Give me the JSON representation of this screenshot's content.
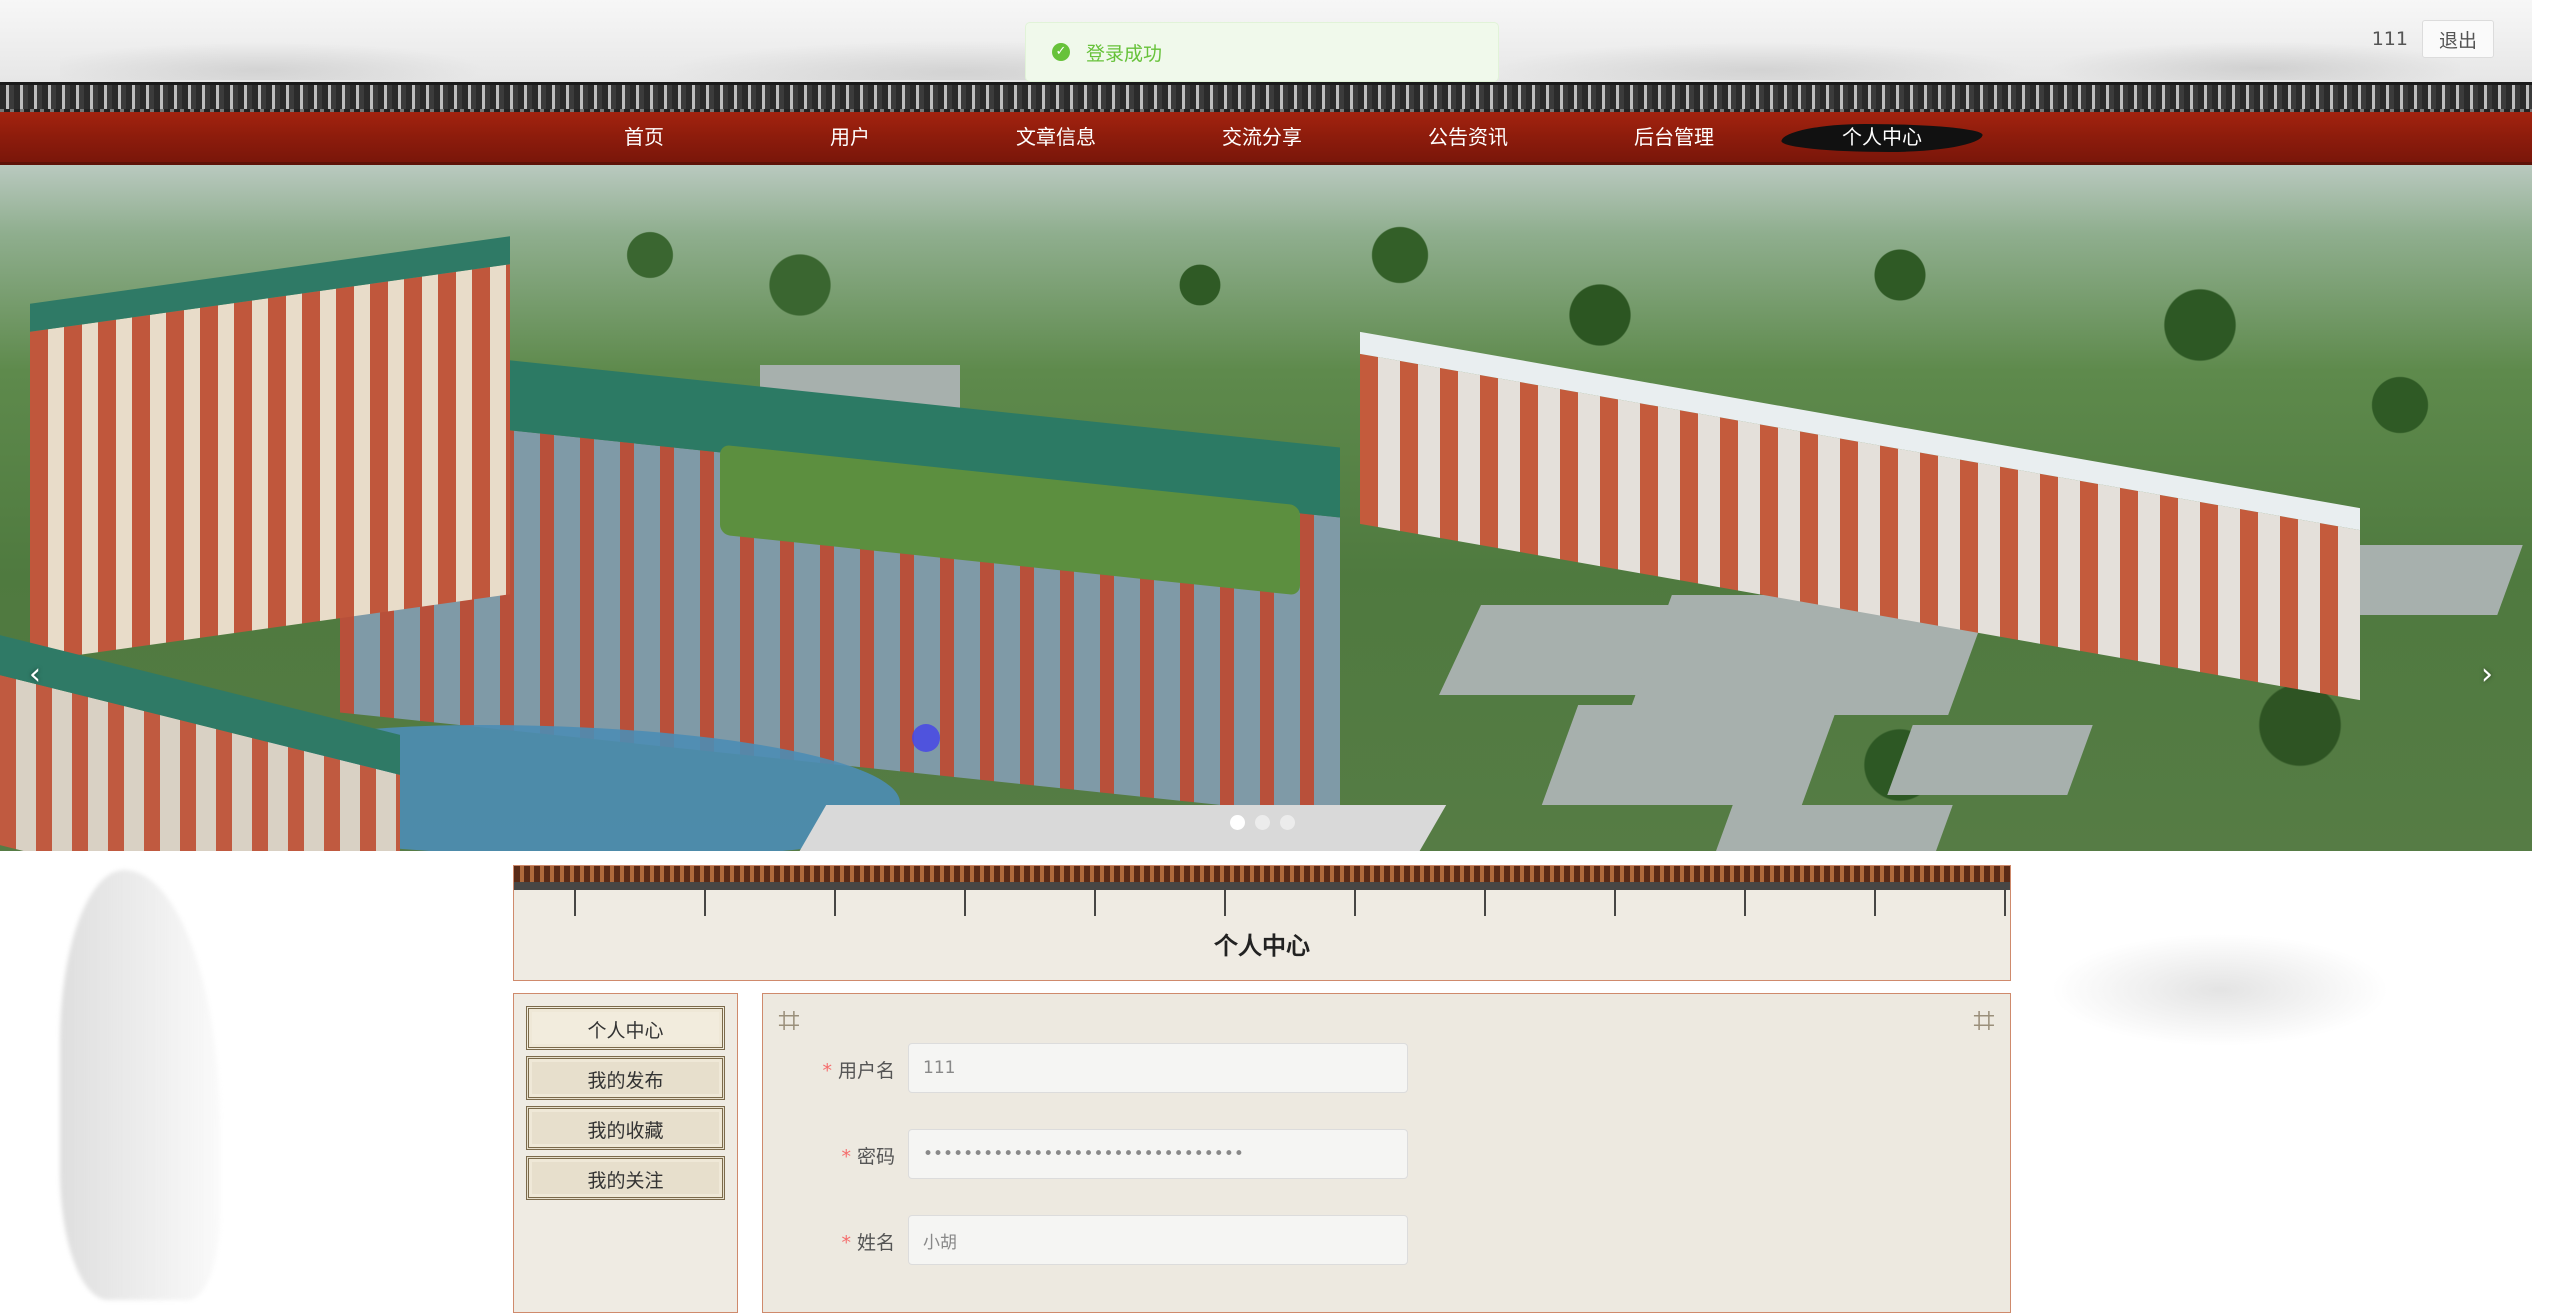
{
  "header": {
    "username": "111",
    "logout_label": "退出"
  },
  "toast": {
    "message": "登录成功",
    "status_color": "#67c23a"
  },
  "nav": {
    "items": [
      {
        "label": "首页",
        "active": false
      },
      {
        "label": "用户",
        "active": false
      },
      {
        "label": "文章信息",
        "active": false
      },
      {
        "label": "交流分享",
        "active": false
      },
      {
        "label": "公告资讯",
        "active": false
      },
      {
        "label": "后台管理",
        "active": false
      },
      {
        "label": "个人中心",
        "active": true
      }
    ],
    "bar_color": "#8d1c0c"
  },
  "banner": {
    "prev_icon": "chevron-left-icon",
    "next_icon": "chevron-right-icon",
    "prev_glyph": "‹",
    "next_glyph": "›",
    "slide_count": 3,
    "active_slide": 1
  },
  "section": {
    "title": "个人中心"
  },
  "side_menu": {
    "items": [
      {
        "label": "个人中心",
        "active": true
      },
      {
        "label": "我的发布",
        "active": false
      },
      {
        "label": "我的收藏",
        "active": false
      },
      {
        "label": "我的关注",
        "active": false
      }
    ]
  },
  "form": {
    "fields": [
      {
        "label": "用户名",
        "required": true,
        "value": "111",
        "type": "text"
      },
      {
        "label": "密码",
        "required": true,
        "value": "••••••••••••••••••••••••••••••••",
        "type": "password"
      },
      {
        "label": "姓名",
        "required": true,
        "value": "小胡",
        "type": "text"
      }
    ],
    "required_mark": "*"
  }
}
